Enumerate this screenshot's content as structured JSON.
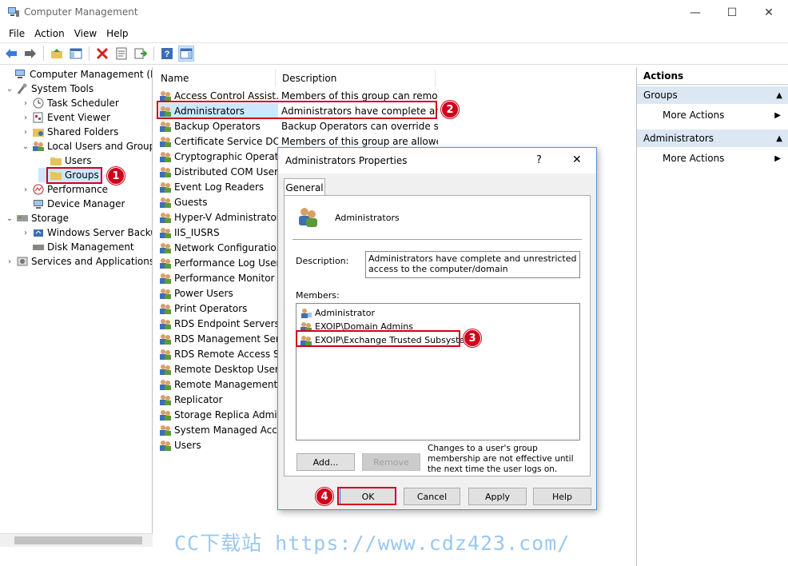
{
  "window": {
    "title": "Computer Management",
    "min": "—",
    "max": "☐",
    "close": "✕"
  },
  "menu": [
    "File",
    "Action",
    "View",
    "Help"
  ],
  "tree": [
    {
      "label": "Computer Management (Local",
      "level": 0,
      "arrow": "",
      "icon": "computer-icon"
    },
    {
      "label": "System Tools",
      "level": 1,
      "arrow": "⌄",
      "icon": "tools-icon"
    },
    {
      "label": "Task Scheduler",
      "level": 2,
      "arrow": "›",
      "icon": "clock-icon"
    },
    {
      "label": "Event Viewer",
      "level": 2,
      "arrow": "›",
      "icon": "event-viewer-icon"
    },
    {
      "label": "Shared Folders",
      "level": 2,
      "arrow": "›",
      "icon": "shared-folder-icon"
    },
    {
      "label": "Local Users and Groups",
      "level": 2,
      "arrow": "⌄",
      "icon": "users-icon"
    },
    {
      "label": "Users",
      "level": 3,
      "arrow": "",
      "icon": "folder-icon"
    },
    {
      "label": "Groups",
      "level": 3,
      "arrow": "",
      "icon": "folder-icon"
    },
    {
      "label": "Performance",
      "level": 2,
      "arrow": "›",
      "icon": "performance-icon"
    },
    {
      "label": "Device Manager",
      "level": 2,
      "arrow": "",
      "icon": "device-manager-icon"
    },
    {
      "label": "Storage",
      "level": 1,
      "arrow": "⌄",
      "icon": "storage-icon"
    },
    {
      "label": "Windows Server Backup",
      "level": 2,
      "arrow": "›",
      "icon": "backup-icon"
    },
    {
      "label": "Disk Management",
      "level": 2,
      "arrow": "",
      "icon": "disk-icon"
    },
    {
      "label": "Services and Applications",
      "level": 1,
      "arrow": "›",
      "icon": "services-icon"
    }
  ],
  "list": {
    "columns": [
      "Name",
      "Description"
    ],
    "rows": [
      {
        "name": "Access Control Assist...",
        "desc": "Members of this group can remot..."
      },
      {
        "name": "Administrators",
        "desc": "Administrators have complete an..."
      },
      {
        "name": "Backup Operators",
        "desc": "Backup Operators can override se..."
      },
      {
        "name": "Certificate Service DC...",
        "desc": "Members of this group are allowe..."
      },
      {
        "name": "Cryptographic Operat...",
        "desc": ""
      },
      {
        "name": "Distributed COM Users",
        "desc": ""
      },
      {
        "name": "Event Log Readers",
        "desc": ""
      },
      {
        "name": "Guests",
        "desc": ""
      },
      {
        "name": "Hyper-V Administrators",
        "desc": ""
      },
      {
        "name": "IIS_IUSRS",
        "desc": ""
      },
      {
        "name": "Network Configuratio...",
        "desc": ""
      },
      {
        "name": "Performance Log Users",
        "desc": ""
      },
      {
        "name": "Performance Monitor ...",
        "desc": ""
      },
      {
        "name": "Power Users",
        "desc": ""
      },
      {
        "name": "Print Operators",
        "desc": ""
      },
      {
        "name": "RDS Endpoint Servers",
        "desc": ""
      },
      {
        "name": "RDS Management Ser...",
        "desc": ""
      },
      {
        "name": "RDS Remote Access S...",
        "desc": ""
      },
      {
        "name": "Remote Desktop Users",
        "desc": ""
      },
      {
        "name": "Remote Management...",
        "desc": ""
      },
      {
        "name": "Replicator",
        "desc": ""
      },
      {
        "name": "Storage Replica Admi...",
        "desc": ""
      },
      {
        "name": "System Managed Acc...",
        "desc": ""
      },
      {
        "name": "Users",
        "desc": ""
      }
    ]
  },
  "actions": {
    "header": "Actions",
    "sections": [
      {
        "title": "Groups",
        "item": "More Actions"
      },
      {
        "title": "Administrators",
        "item": "More Actions"
      }
    ]
  },
  "dialog": {
    "title": "Administrators Properties",
    "help": "?",
    "close": "✕",
    "tab": "General",
    "group_name": "Administrators",
    "description_label": "Description:",
    "description_value": "Administrators have complete and unrestricted access to the computer/domain",
    "members_label": "Members:",
    "members": [
      "Administrator",
      "EXOIP\\Domain Admins",
      "EXOIP\\Exchange Trusted Subsystem"
    ],
    "add": "Add...",
    "remove": "Remove",
    "note": "Changes to a user's group membership are not effective until the next time the user logs on.",
    "ok": "OK",
    "cancel": "Cancel",
    "apply": "Apply",
    "help_btn": "Help"
  },
  "callouts": [
    "1",
    "2",
    "3",
    "4"
  ],
  "watermark": "CC下载站 https://www.cdz423.com/",
  "colors": {
    "accent": "#d0021b",
    "selection": "#cce8ff",
    "section": "#dce7f4"
  }
}
